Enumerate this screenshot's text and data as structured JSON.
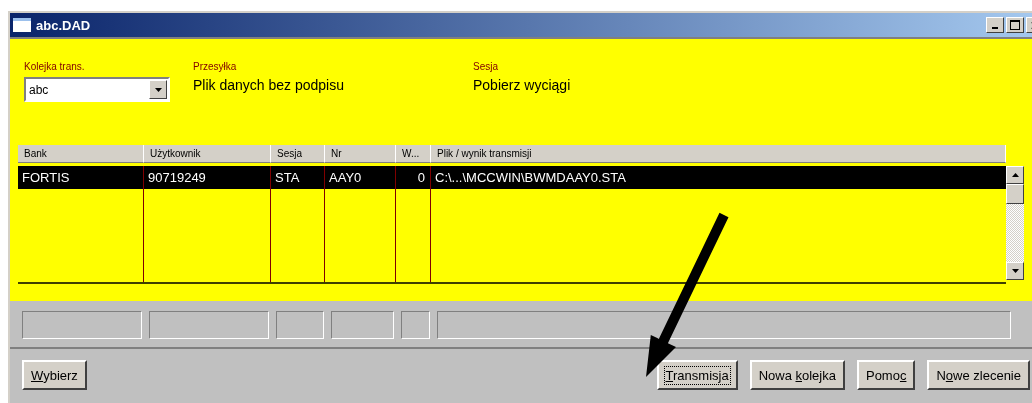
{
  "window": {
    "title": "abc.DAD"
  },
  "header_fields": [
    {
      "kind": "combo",
      "label": "Kolejka trans.",
      "value": "abc"
    },
    {
      "kind": "text",
      "label": "Przesyłka",
      "value": "Plik danych bez podpisu"
    },
    {
      "kind": "text",
      "label": "Sesja",
      "value": "Pobierz wyciągi"
    }
  ],
  "table": {
    "columns": [
      "Bank",
      "Użytkownik",
      "Sesja",
      "Nr",
      "W...",
      "Plik / wynik transmisji"
    ],
    "rows": [
      {
        "selected": true,
        "cells": [
          "FORTIS",
          "90719249",
          "STA",
          "AAY0",
          "0",
          "C:\\...\\MCCWIN\\BWMDAAY0.STA"
        ]
      }
    ]
  },
  "buttons": [
    {
      "kind": "left",
      "focused": false,
      "label": [
        {
          "text": "W",
          "underlined": true
        },
        {
          "text": "ybierz",
          "underlined": false
        }
      ]
    },
    {
      "kind": "right",
      "focused": true,
      "label": [
        {
          "text": "T",
          "underlined": true
        },
        {
          "text": "ransmisja",
          "underlined": false
        }
      ]
    },
    {
      "kind": "right",
      "focused": false,
      "label": [
        {
          "text": "Nowa ",
          "underlined": false
        },
        {
          "text": "k",
          "underlined": true
        },
        {
          "text": "olejka",
          "underlined": false
        }
      ]
    },
    {
      "kind": "right",
      "focused": false,
      "label": [
        {
          "text": "Pomo",
          "underlined": false
        },
        {
          "text": "c",
          "underlined": true
        }
      ]
    },
    {
      "kind": "right",
      "focused": false,
      "label": [
        {
          "text": "N",
          "underlined": false
        },
        {
          "text": "o",
          "underlined": true
        },
        {
          "text": "we zlecenie",
          "underlined": false
        }
      ]
    }
  ]
}
